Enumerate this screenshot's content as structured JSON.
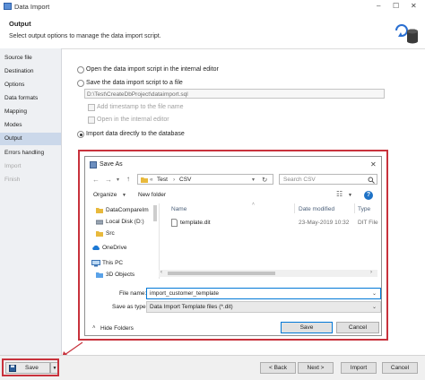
{
  "window": {
    "title": "Data Import"
  },
  "header": {
    "title": "Output",
    "subtitle": "Select output options to manage the data import script."
  },
  "sidebar": {
    "items": [
      {
        "label": "Source file",
        "state": "normal"
      },
      {
        "label": "Destination",
        "state": "normal"
      },
      {
        "label": "Options",
        "state": "normal"
      },
      {
        "label": "Data formats",
        "state": "normal"
      },
      {
        "label": "Mapping",
        "state": "normal"
      },
      {
        "label": "Modes",
        "state": "normal"
      },
      {
        "label": "Output",
        "state": "active"
      },
      {
        "label": "Errors handling",
        "state": "normal"
      },
      {
        "label": "Import",
        "state": "disabled"
      },
      {
        "label": "Finish",
        "state": "disabled"
      }
    ]
  },
  "output": {
    "open_editor": "Open the data import script in the internal editor",
    "save_file": "Save the data import script to a file",
    "file_path": "D:\\Test\\CreateDbProject\\dataimport.sql",
    "add_timestamp": "Add timestamp to the file name",
    "open_internal": "Open in the internal editor",
    "import_directly": "Import data directly to the database"
  },
  "save_dialog": {
    "title": "Save As",
    "breadcrumb": [
      "Test",
      "CSV"
    ],
    "search_placeholder": "Search CSV",
    "organize": "Organize",
    "new_folder": "New folder",
    "nav": [
      {
        "label": "DataCompareIm",
        "icon": "folder-icon"
      },
      {
        "label": "Local Disk (D:)",
        "icon": "disk-icon"
      },
      {
        "label": "Src",
        "icon": "folder-icon"
      },
      {
        "label": "OneDrive",
        "icon": "cloud-icon"
      },
      {
        "label": "This PC",
        "icon": "pc-icon"
      },
      {
        "label": "3D Objects",
        "icon": "folder-icon"
      }
    ],
    "columns": {
      "name": "Name",
      "date": "Date modified",
      "type": "Type"
    },
    "files": [
      {
        "name": "template.dit",
        "date": "23-May-2019 10:32",
        "type": "DIT File"
      }
    ],
    "filename_label": "File name:",
    "filename_value": "import_customer_template",
    "saveas_label": "Save as type:",
    "saveas_value": "Data Import Template files (*.dit)",
    "hide_folders": "Hide Folders",
    "save_button": "Save",
    "cancel_button": "Cancel"
  },
  "footer": {
    "save": "Save",
    "back": "< Back",
    "next": "Next >",
    "import": "Import",
    "cancel": "Cancel"
  },
  "colors": {
    "highlight": "#c8323c",
    "accent": "#0078d7",
    "sidebar_active": "#cbd8ea"
  }
}
